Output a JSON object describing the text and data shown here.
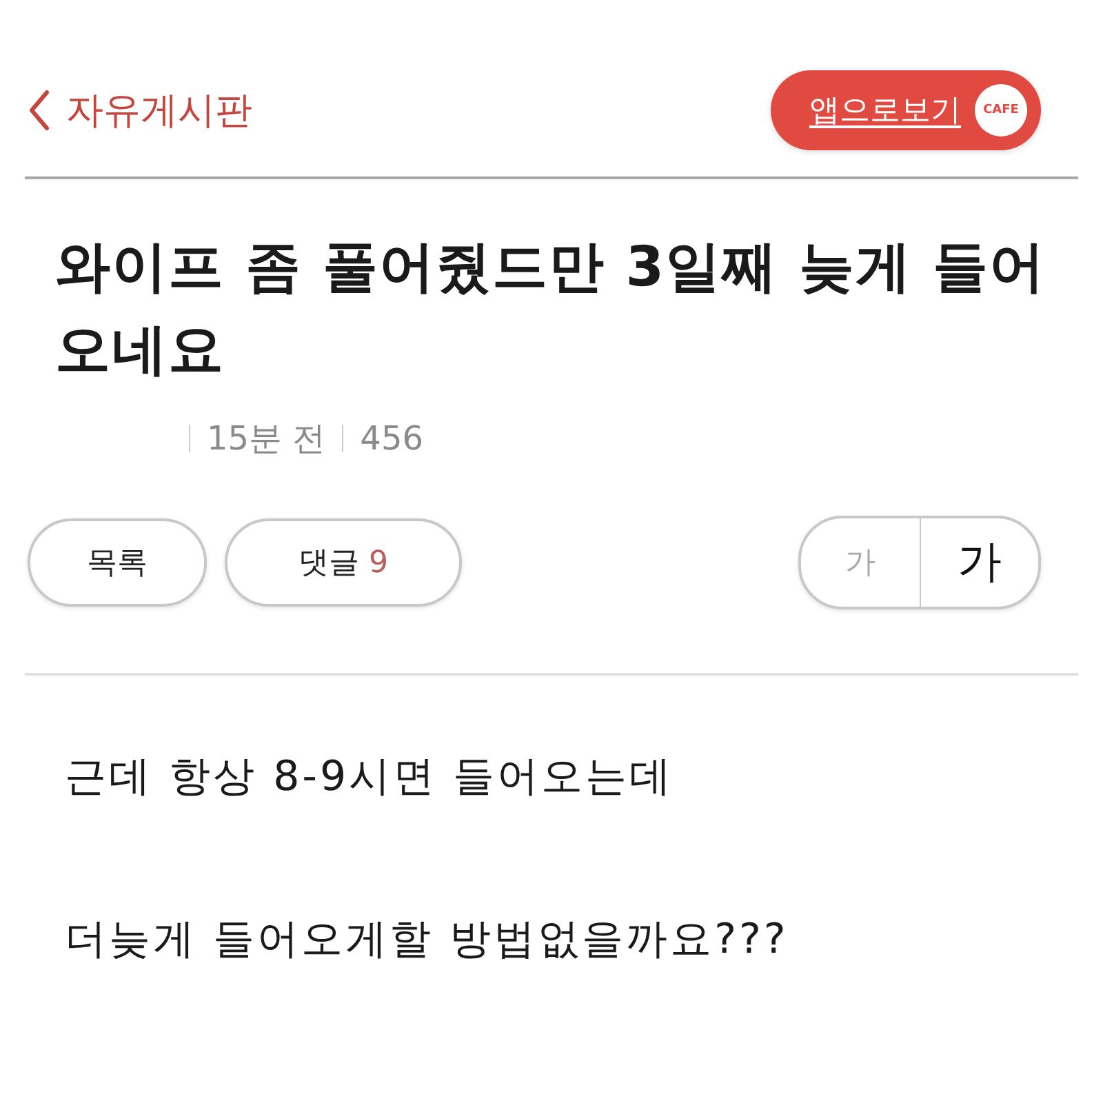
{
  "header": {
    "back_label": "자유게시판",
    "app_button": {
      "label": "앱으로보기",
      "logo_text": "CAFE"
    }
  },
  "post": {
    "title": "와이프 좀 풀어줬드만 3일째 늦게 들어오네요",
    "time": "15분 전",
    "views": "456"
  },
  "actions": [
    {
      "kind": "list",
      "label": "목록"
    },
    {
      "kind": "comments",
      "label": "댓글",
      "count": "9"
    }
  ],
  "font_size_buttons": [
    {
      "kind": "small",
      "label": "가"
    },
    {
      "kind": "large",
      "label": "가"
    }
  ],
  "body": [
    "근데 항상 8-9시면 들어오는데",
    "더늦게 들어오게할 방법없을까요???"
  ]
}
